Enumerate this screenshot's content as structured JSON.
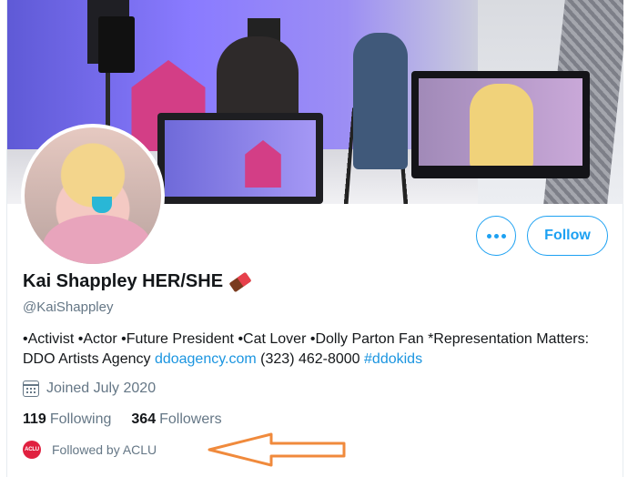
{
  "profile": {
    "display_name": "Kai Shappley HER/SHE",
    "handle": "@KaiShappley",
    "bio_text_1": "•Activist •Actor •Future President •Cat Lover •Dolly Parton Fan *Representation Matters: DDO Artists Agency ",
    "bio_link": "ddoagency.com",
    "bio_text_2": " (323) 462-8000 ",
    "bio_hashtag": "#ddokids",
    "joined": "Joined July 2020",
    "following_count": "119",
    "following_label": "Following",
    "followers_count": "364",
    "followers_label": "Followers",
    "followed_by": "Followed by ACLU",
    "followed_by_avatar_text": "ACLU"
  },
  "actions": {
    "follow_label": "Follow"
  },
  "icons": {
    "name_emoji": "chocolate-bar-icon",
    "more": "more-dots-icon",
    "joined": "calendar-icon"
  },
  "colors": {
    "accent": "#1da1f2",
    "link": "#1b95e0",
    "secondary_text": "#657786",
    "annotation_arrow": "#f08a3c",
    "aclu_red": "#e0203f"
  }
}
